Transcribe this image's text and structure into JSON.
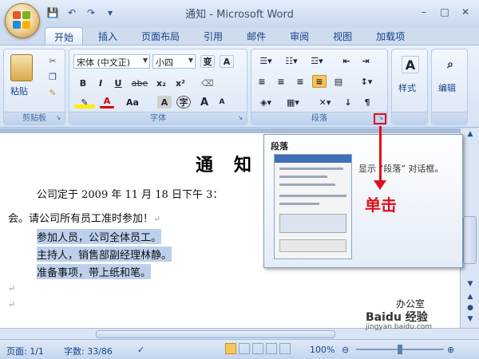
{
  "window": {
    "title": "通知 - Microsoft Word",
    "minimize": "–",
    "maximize": "□",
    "close": "✕"
  },
  "qat": [
    "💾",
    "↶",
    "↷",
    "▾"
  ],
  "tabs": [
    {
      "label": "开始",
      "active": true
    },
    {
      "label": "插入"
    },
    {
      "label": "页面布局"
    },
    {
      "label": "引用"
    },
    {
      "label": "邮件"
    },
    {
      "label": "审阅"
    },
    {
      "label": "视图"
    },
    {
      "label": "加载项"
    }
  ],
  "ribbon": {
    "clipboard": {
      "label": "剪贴板",
      "paste": "粘贴"
    },
    "font": {
      "label": "字体",
      "font_name": "宋体 (中文正)",
      "font_size": "小四",
      "bold": "B",
      "italic": "I",
      "underline": "U",
      "strike": "abe",
      "subscript": "x₂",
      "superscript": "x²",
      "grow": "A",
      "shrink": "A",
      "change_case": "Aa"
    },
    "paragraph": {
      "label": "段落"
    },
    "styles": {
      "label": "样式"
    },
    "editing": {
      "label": "编辑"
    }
  },
  "document": {
    "title": "通　知",
    "line1": "公司定于 2009 年 11 月 18 日下午 3：",
    "line2": "会。请公司所有员工准时参加！",
    "line3": "参加人员，公司全体员工。",
    "line4": "主持人，销售部副经理林静。",
    "line5": "准备事项，带上纸和笔。"
  },
  "tooltip": {
    "title": "段落",
    "description": "显示 “段落” 对话框。"
  },
  "annotation": {
    "label": "单击"
  },
  "statusbar": {
    "page": "页面: 1/1",
    "words": "字数: 33/86",
    "zoom": "100%"
  },
  "watermark": {
    "brand": "Baidu 经验",
    "url": "jingyan.baidu.com",
    "office": "办公室"
  },
  "colors": {
    "accent": "#15428b",
    "annotation": "#e0101c",
    "selection": "#bcd0ec"
  }
}
